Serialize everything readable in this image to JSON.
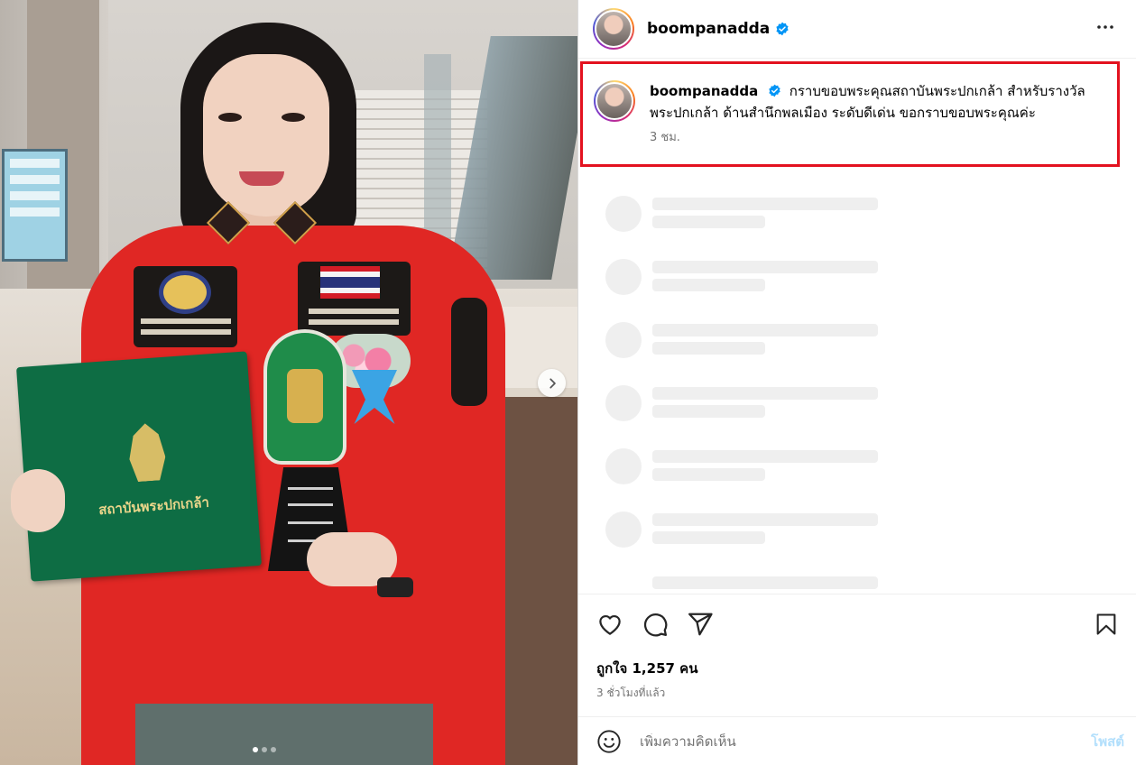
{
  "post": {
    "image_alt": "",
    "folder_text": "สถาบันพระปกเกล้า",
    "carousel": {
      "count": 3,
      "active": 0
    }
  },
  "header": {
    "username": "boompanadda"
  },
  "caption": {
    "username": "boompanadda",
    "text": "กราบขอบพระคุณสถาบันพระปกเกล้า สำหรับรางวัลพระปกเกล้า ด้านสำนึกพลเมือง ระดับดีเด่น ขอกราบขอบพระคุณค่ะ",
    "time": "3 ชม.",
    "highlight_color": "#e3121f"
  },
  "comments_loading": {
    "placeholder_rows": 7
  },
  "actions": {
    "likes": "ถูกใจ 1,257 คน",
    "time_ago": "3 ชั่วโมงที่แล้ว"
  },
  "comment_box": {
    "placeholder": "เพิ่มความคิดเห็น",
    "post_label": "โพสต์"
  },
  "colors": {
    "verified": "#0095f6",
    "post_button": "#b2dffc",
    "secondary_text": "#737373"
  },
  "icons": [
    "verified-badge-icon",
    "more-options-icon",
    "heart-icon",
    "comment-icon",
    "share-icon",
    "bookmark-icon",
    "emoji-icon",
    "chevron-right-icon"
  ]
}
